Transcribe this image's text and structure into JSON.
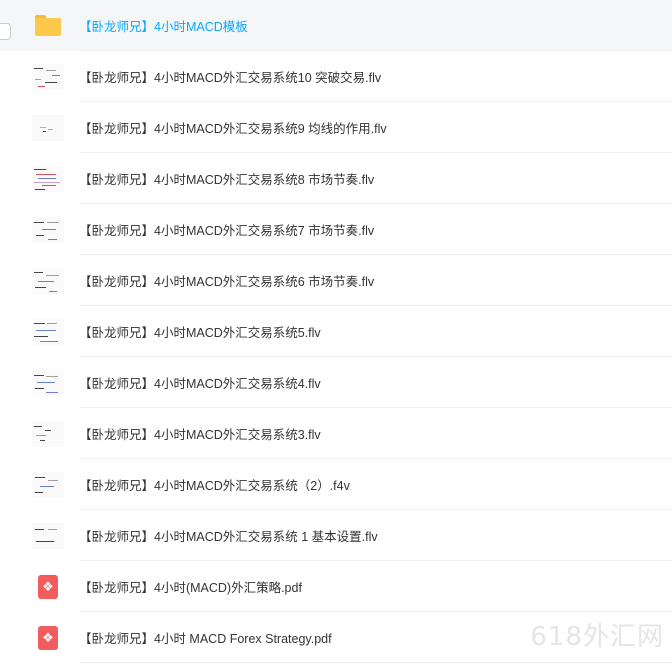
{
  "files": [
    {
      "name": "【卧龙师兄】4小时MACD模板",
      "icon": "folder-icon",
      "selected": true
    },
    {
      "name": "【卧龙师兄】4小时MACD外汇交易系统10 突破交易.flv",
      "icon": "video-thumbnail"
    },
    {
      "name": "【卧龙师兄】4小时MACD外汇交易系统9 均线的作用.flv",
      "icon": "video-thumbnail"
    },
    {
      "name": "【卧龙师兄】4小时MACD外汇交易系统8 市场节奏.flv",
      "icon": "video-thumbnail"
    },
    {
      "name": "【卧龙师兄】4小时MACD外汇交易系统7 市场节奏.flv",
      "icon": "video-thumbnail"
    },
    {
      "name": "【卧龙师兄】4小时MACD外汇交易系统6 市场节奏.flv",
      "icon": "video-thumbnail"
    },
    {
      "name": "【卧龙师兄】4小时MACD外汇交易系统5.flv",
      "icon": "video-thumbnail"
    },
    {
      "name": "【卧龙师兄】4小时MACD外汇交易系统4.flv",
      "icon": "video-thumbnail"
    },
    {
      "name": "【卧龙师兄】4小时MACD外汇交易系统3.flv",
      "icon": "video-thumbnail"
    },
    {
      "name": "【卧龙师兄】4小时MACD外汇交易系统（2）.f4v",
      "icon": "video-thumbnail"
    },
    {
      "name": "【卧龙师兄】4小时MACD外汇交易系统 1 基本设置.flv",
      "icon": "video-thumbnail"
    },
    {
      "name": "【卧龙师兄】4小时(MACD)外汇策略.pdf",
      "icon": "pdf-icon"
    },
    {
      "name": "【卧龙师兄】4小时 MACD Forex Strategy.pdf",
      "icon": "pdf-icon"
    }
  ],
  "watermark": "618外汇网",
  "colors": {
    "selected_text": "#06a7ff",
    "selected_row_bg": "#f5f6f8",
    "folder": "#fcc94b",
    "pdf": "#f25c5c"
  }
}
